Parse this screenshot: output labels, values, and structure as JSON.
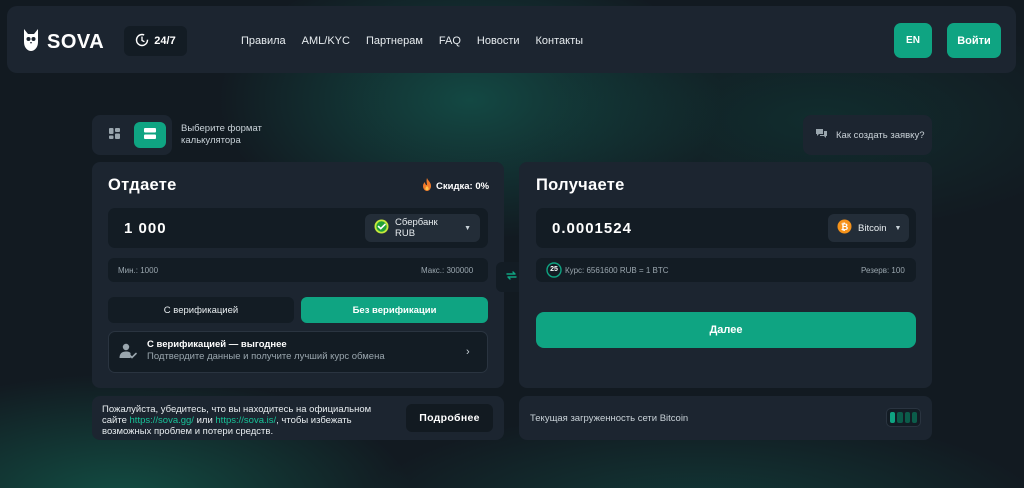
{
  "header": {
    "logo_text": "SOVA",
    "support_label": "24/7",
    "nav": [
      "Правила",
      "AML/KYC",
      "Партнерам",
      "FAQ",
      "Новости",
      "Контакты"
    ],
    "lang_label": "EN",
    "login_label": "Войти"
  },
  "toolbar": {
    "format_hint": "Выберите формат калькулятора",
    "howto_label": "Как создать заявку?",
    "active_format": "list"
  },
  "give": {
    "title": "Отдаете",
    "discount_label": "Скидка: 0%",
    "amount": "1 000",
    "currency": "Сбербанк RUB",
    "min_label": "Мин.: 1000",
    "max_label": "Макс.: 300000",
    "tab_verified": "С верификацией",
    "tab_unverified": "Без верификации",
    "active_tab": "unverified",
    "verify_title": "С верификацией — выгоднее",
    "verify_subtitle": "Подтвердите данные и получите лучший курс обмена"
  },
  "get": {
    "title": "Получаете",
    "amount": "0.0001524",
    "currency": "Bitcoin",
    "rate_timer": "25",
    "rate_label": "Курс: 6561600 RUB = 1 BTC",
    "reserve_label": "Резерв: 100",
    "next_label": "Далее"
  },
  "notice": {
    "text_before": "Пожалуйста, убедитесь, что вы находитесь на официальном сайте",
    "link1": "https://sova.gg/",
    "text_or": " или ",
    "link2": "https://sova.is/",
    "text_after": ", чтобы избежать возможных проблем и потери средств.",
    "more_label": "Подробнее"
  },
  "network": {
    "label": "Текущая загруженность сети Bitcoin",
    "load_level_bars": 1,
    "load_total_bars": 4
  },
  "colors": {
    "accent": "#0fa482",
    "panel": "#1c2530",
    "input_bg": "#131c24",
    "background": "#121a21"
  }
}
